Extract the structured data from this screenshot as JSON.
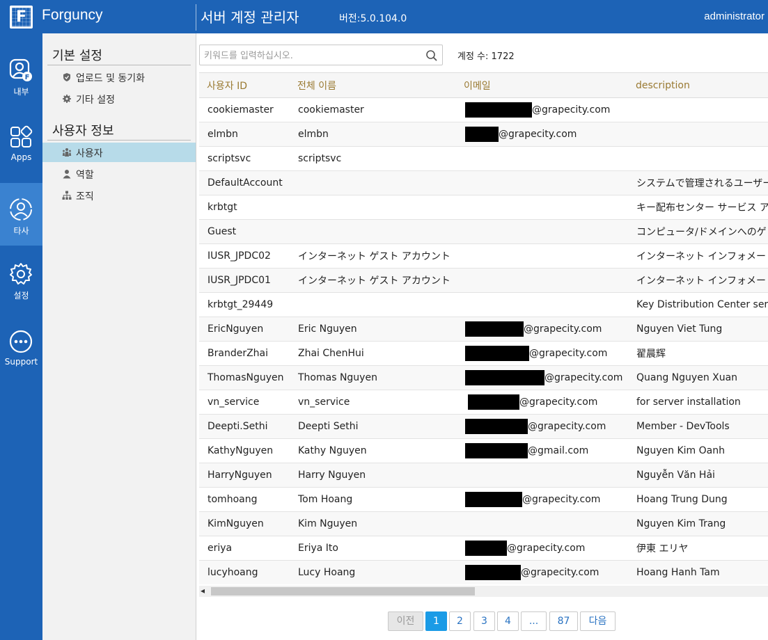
{
  "header": {
    "brand": "Forguncy",
    "logo_letter": "F",
    "title": "서버 계정 관리자",
    "version": "버전:5.0.104.0",
    "user": "administrator"
  },
  "leftnav": {
    "items": [
      {
        "label": "내부",
        "icon": "internal-user-icon",
        "active": false
      },
      {
        "label": "Apps",
        "icon": "apps-icon",
        "active": false
      },
      {
        "label": "타사",
        "icon": "third-party-icon",
        "active": true
      },
      {
        "label": "설정",
        "icon": "gear-icon",
        "active": false
      },
      {
        "label": "Support",
        "icon": "support-icon",
        "active": false
      }
    ]
  },
  "sidebar": {
    "section1_title": "기본 설정",
    "section1_items": [
      {
        "label": "업로드 및 동기화",
        "icon": "shield-icon"
      },
      {
        "label": "기타 설정",
        "icon": "gear-icon"
      }
    ],
    "section2_title": "사용자 정보",
    "section2_items": [
      {
        "label": "사용자",
        "icon": "users-icon",
        "selected": true
      },
      {
        "label": "역할",
        "icon": "person-icon",
        "selected": false
      },
      {
        "label": "조직",
        "icon": "org-chart-icon",
        "selected": false
      }
    ]
  },
  "search": {
    "placeholder": "키워드를 입력하십시오.",
    "value": ""
  },
  "count_label": "계정 수: 1722",
  "table": {
    "columns": [
      "사용자 ID",
      "전체 이름",
      "이메일",
      "description"
    ],
    "rows": [
      {
        "id": "cookiemaster",
        "name": "cookiemaster",
        "email_domain": "@grapecity.com",
        "desc": ""
      },
      {
        "id": "elmbn",
        "name": "elmbn",
        "email_domain": "@grapecity.com",
        "desc": ""
      },
      {
        "id": "scriptsvc",
        "name": "scriptsvc",
        "email_domain": "",
        "desc": ""
      },
      {
        "id": "DefaultAccount",
        "name": "",
        "email_domain": "",
        "desc": "システムで管理されるユーザー"
      },
      {
        "id": "krbtgt",
        "name": "",
        "email_domain": "",
        "desc": "キー配布センター サービス ア"
      },
      {
        "id": "Guest",
        "name": "",
        "email_domain": "",
        "desc": "コンピュータ/ドメインへのゲ"
      },
      {
        "id": "IUSR_JPDC02",
        "name": "インターネット ゲスト アカウント",
        "email_domain": "",
        "desc": "インターネット インフォメー"
      },
      {
        "id": "IUSR_JPDC01",
        "name": "インターネット ゲスト アカウント",
        "email_domain": "",
        "desc": "インターネット インフォメー"
      },
      {
        "id": "krbtgt_29449",
        "name": "",
        "email_domain": "",
        "desc": "Key Distribution Center serv"
      },
      {
        "id": "EricNguyen",
        "name": "Eric Nguyen",
        "email_domain": "@grapecity.com",
        "desc": "Nguyen Viet Tung"
      },
      {
        "id": "BranderZhai",
        "name": "Zhai ChenHui",
        "email_domain": "@grapecity.com",
        "desc": "翟晨辉"
      },
      {
        "id": "ThomasNguyen",
        "name": "Thomas Nguyen",
        "email_domain": "@grapecity.com",
        "desc": "Quang Nguyen Xuan"
      },
      {
        "id": "vn_service",
        "name": "vn_service",
        "email_domain": "@grapecity.com",
        "desc": "for server installation"
      },
      {
        "id": "Deepti.Sethi",
        "name": "Deepti Sethi",
        "email_domain": "@grapecity.com",
        "desc": "Member - DevTools"
      },
      {
        "id": "KathyNguyen",
        "name": "Kathy Nguyen",
        "email_domain": "@gmail.com",
        "desc": "Nguyen Kim Oanh"
      },
      {
        "id": "HarryNguyen",
        "name": "Harry Nguyen",
        "email_domain": "",
        "desc": "Nguyễn Văn Hải"
      },
      {
        "id": "tomhoang",
        "name": "Tom Hoang",
        "email_domain": "@grapecity.com",
        "desc": "Hoang Trung Dung"
      },
      {
        "id": "KimNguyen",
        "name": "Kim Nguyen",
        "email_domain": "",
        "desc": "Nguyen Kim Trang"
      },
      {
        "id": "eriya",
        "name": "Eriya Ito",
        "email_domain": "@grapecity.com",
        "desc": "伊東 エリヤ"
      },
      {
        "id": "lucyhoang",
        "name": "Lucy Hoang",
        "email_domain": "@grapecity.com",
        "desc": "Hoang Hanh Tam"
      }
    ]
  },
  "pager": {
    "prev": "이전",
    "pages": [
      "1",
      "2",
      "3",
      "4",
      "...",
      "87"
    ],
    "current": "1",
    "next": "다음"
  },
  "colors": {
    "brand_blue": "#1d63b6",
    "nav_active": "#3a82d0",
    "sidebar_selected": "#b7dbe9",
    "header_text_gold": "#9a7a32",
    "pager_active": "#1a9be6"
  }
}
